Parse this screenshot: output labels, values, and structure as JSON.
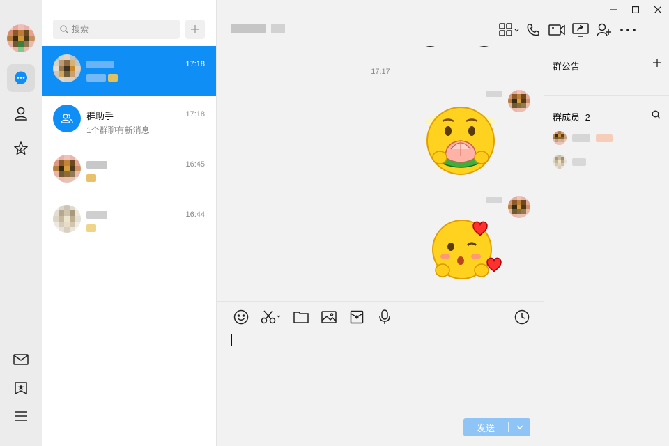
{
  "app": {
    "accent": "#0f8ef6"
  },
  "nav": {
    "items": [
      "chat-bubble-icon",
      "contacts-icon",
      "favorites-star-icon",
      "mail-icon",
      "bookmark-icon",
      "menu-icon"
    ]
  },
  "search": {
    "placeholder": "搜索"
  },
  "conversations": [
    {
      "name": "",
      "message": "",
      "time": "17:18",
      "selected": true
    },
    {
      "name": "群助手",
      "message": "1个群聊有新消息",
      "time": "17:18",
      "selected": false
    },
    {
      "name": "",
      "message": "",
      "time": "16:45",
      "selected": false
    },
    {
      "name": "",
      "message": "",
      "time": "16:44",
      "selected": false
    }
  ],
  "chat": {
    "timestamp": "17:17",
    "messages": [
      {
        "type": "sticker",
        "sticker": "peach-holding-emoji"
      },
      {
        "type": "sticker",
        "sticker": "blowing-kiss-hearts-emoji"
      }
    ]
  },
  "composer": {
    "send_label": "发送"
  },
  "side": {
    "notice_title": "群公告",
    "members_title": "群成员",
    "members_count": "2"
  }
}
